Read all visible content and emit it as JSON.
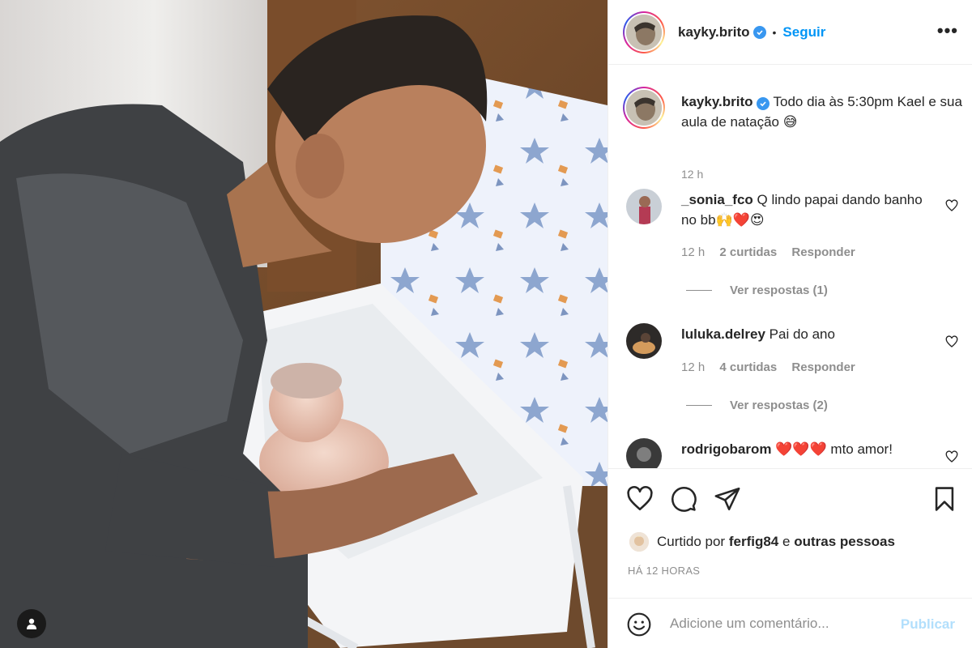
{
  "post": {
    "username": "kayky.brito",
    "follow_label": "Seguir",
    "separator": "•",
    "more_label": "•••"
  },
  "caption": {
    "username": "kayky.brito",
    "text": "Todo dia às 5:30pm Kael e sua aula de natação 😅",
    "time": "12 h"
  },
  "comments": [
    {
      "username": "_sonia_fco",
      "text": "Q lindo papai dando banho no bb🙌❤️😍",
      "time": "12 h",
      "likes": "2 curtidas",
      "reply_label": "Responder",
      "view_replies": "Ver respostas (1)"
    },
    {
      "username": "luluka.delrey",
      "text": "Pai do ano",
      "time": "12 h",
      "likes": "4 curtidas",
      "reply_label": "Responder",
      "view_replies": "Ver respostas (2)"
    },
    {
      "username": "rodrigobarom",
      "text": "❤️❤️❤️ mto amor!"
    }
  ],
  "likes": {
    "prefix": "Curtido por",
    "user": "ferfig84",
    "conj": "e",
    "others": "outras pessoas"
  },
  "timestamp": "HÁ 12 HORAS",
  "add_comment": {
    "placeholder": "Adicione um comentário...",
    "post_label": "Publicar"
  },
  "colors": {
    "accent": "#0095f6",
    "muted": "#8e8e8e",
    "text": "#262626",
    "publish_disabled": "#b2dffc",
    "verified": "#3897f0"
  },
  "icons": [
    "heart-icon",
    "comment-icon",
    "share-icon",
    "bookmark-icon",
    "emoji-icon",
    "user-tag-icon",
    "verified-badge-icon",
    "more-options-icon"
  ]
}
